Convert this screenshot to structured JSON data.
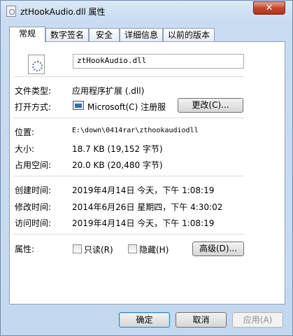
{
  "window": {
    "title": "ztHookAudio.dll 属性",
    "close_label": "✕"
  },
  "tabs": [
    {
      "label": "常规",
      "active": true
    },
    {
      "label": "数字签名",
      "active": false
    },
    {
      "label": "安全",
      "active": false
    },
    {
      "label": "详细信息",
      "active": false
    },
    {
      "label": "以前的版本",
      "active": false
    }
  ],
  "general": {
    "file_name": "ztHookAudio.dll",
    "file_type_label": "文件类型:",
    "file_type_value": "应用程序扩展 (.dll)",
    "opens_with_label": "打开方式:",
    "opens_with_value": "Microsoft(C) 注册服",
    "change_button": "更改(C)...",
    "location_label": "位置:",
    "location_value": "E:\\down\\0414rar\\zthookaudiodll",
    "size_label": "大小:",
    "size_value": "18.7 KB (19,152 字节)",
    "size_on_disk_label": "占用空间:",
    "size_on_disk_value": "20.0 KB (20,480 字节)",
    "created_label": "创建时间:",
    "created_value": "2019年4月14日 今天，下午 1:08:19",
    "modified_label": "修改时间:",
    "modified_value": "2014年6月26日 星期四，下午 4:30:02",
    "accessed_label": "访问时间:",
    "accessed_value": "2019年4月14日 今天，下午 1:08:19",
    "attributes_label": "属性:",
    "readonly_label": "只读(R)",
    "hidden_label": "隐藏(H)",
    "advanced_button": "高级(D)..."
  },
  "buttons": {
    "ok": "确定",
    "cancel": "取消",
    "apply": "应用(A)"
  },
  "colors": {
    "accent": "#3c7fb1",
    "window_frame": "#c4d8ef",
    "close": "#c4452c"
  }
}
